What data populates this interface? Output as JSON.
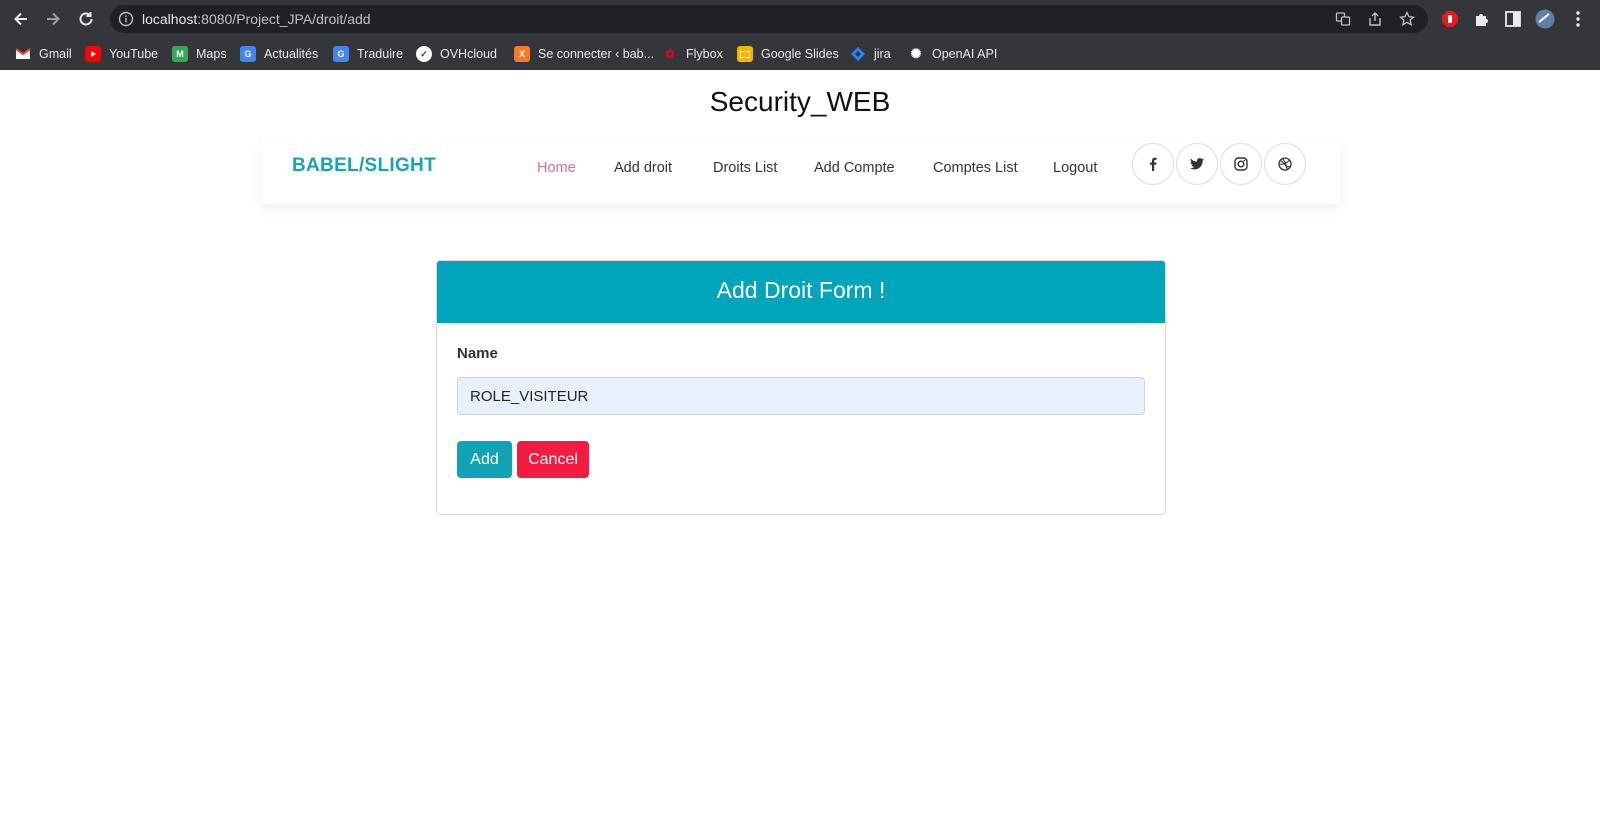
{
  "browser": {
    "url_host": "localhost",
    "url_rest": ":8080/Project_JPA/droit/add",
    "bookmarks": [
      {
        "label": "Gmail",
        "icon": "gmail-icon",
        "color": "#ea4335"
      },
      {
        "label": "YouTube",
        "icon": "youtube-icon",
        "color": "#ff0000"
      },
      {
        "label": "Maps",
        "icon": "maps-icon",
        "color": "#34a853"
      },
      {
        "label": "Actualités",
        "icon": "news-icon",
        "color": "#4285f4"
      },
      {
        "label": "Traduire",
        "icon": "translate-icon",
        "color": "#4285f4"
      },
      {
        "label": "OVHcloud",
        "icon": "ovhcloud-icon",
        "color": "#ffffff"
      },
      {
        "label": "Se connecter ‹ bab...",
        "icon": "xampp-icon",
        "color": "#fb7a24"
      },
      {
        "label": "Flybox",
        "icon": "huawei-icon",
        "color": "#cf0a2c"
      },
      {
        "label": "Google Slides",
        "icon": "slides-icon",
        "color": "#f4b400"
      },
      {
        "label": "jira",
        "icon": "jira-icon",
        "color": "#2684ff"
      },
      {
        "label": "OpenAI API",
        "icon": "openai-icon",
        "color": "#ffffff"
      }
    ]
  },
  "site": {
    "title": "Security_WEB",
    "brand": "BABEL/SLIGHT",
    "nav": [
      {
        "label": "Home",
        "active": true
      },
      {
        "label": "Add droit",
        "active": false
      },
      {
        "label": "Droits List",
        "active": false
      },
      {
        "label": "Add Compte",
        "active": false
      },
      {
        "label": "Comptes List",
        "active": false
      },
      {
        "label": "Logout",
        "active": false
      }
    ],
    "social_icons": [
      "facebook-icon",
      "twitter-icon",
      "instagram-icon",
      "dribbble-icon"
    ]
  },
  "form": {
    "header": "Add Droit Form !",
    "name_label": "Name",
    "name_value": "ROLE_VISITEUR",
    "add_label": "Add",
    "cancel_label": "Cancel"
  },
  "colors": {
    "brand": "#16a4b3",
    "active_nav": "#e86a92",
    "card_header": "#00a4bb",
    "add_button": "#11a2b4",
    "cancel_button": "#f11c3f"
  }
}
